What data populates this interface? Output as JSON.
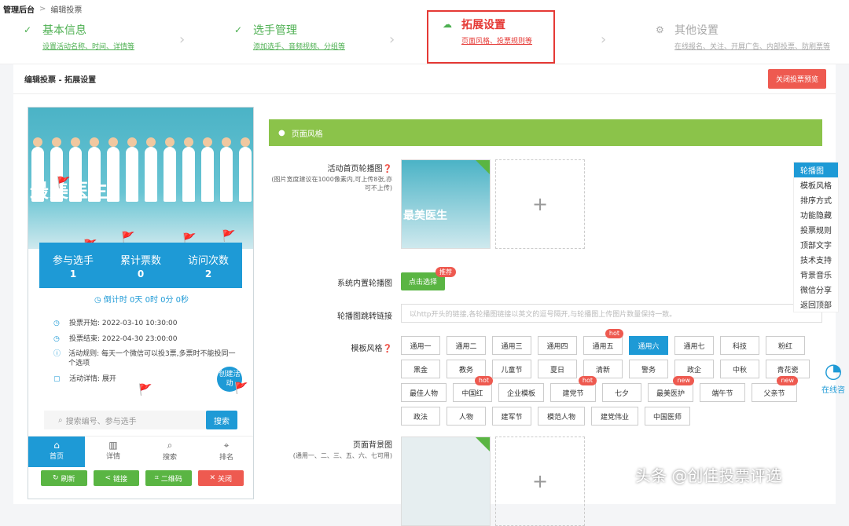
{
  "breadcrumb": {
    "home": "管理后台",
    "sep": ">",
    "current": "编辑投票"
  },
  "steps": [
    {
      "title": "基本信息",
      "sub": "设置活动名称、时间、详情等",
      "status": "done"
    },
    {
      "title": "选手管理",
      "sub": "添加选手、音频视频、分组等",
      "status": "done"
    },
    {
      "title": "拓展设置",
      "sub": "页面风格、投票规则等",
      "status": "active"
    },
    {
      "title": "其他设置",
      "sub": "在线报名、关注、开屏广告、内部投票、防刷票等",
      "status": "pending"
    }
  ],
  "panel": {
    "title": "编辑投票 - 拓展设置",
    "close_preview": "关闭投票预览"
  },
  "preview": {
    "banner_title": "最美医生",
    "stats": [
      {
        "label": "参与选手",
        "value": "1"
      },
      {
        "label": "累计票数",
        "value": "0"
      },
      {
        "label": "访问次数",
        "value": "2"
      }
    ],
    "countdown": "倒计时 0天 0时 0分 0秒",
    "info": [
      {
        "icon": "clock-icon",
        "glyph": "◷",
        "text": "投票开始: 2022-03-10 10:30:00"
      },
      {
        "icon": "clock-icon",
        "glyph": "◷",
        "text": "投票结束: 2022-04-30 23:00:00"
      },
      {
        "icon": "info-icon",
        "glyph": "ⓘ",
        "text": "活动规则: 每天一个微信可以投3票,多票时不能投同一个选项"
      },
      {
        "icon": "detail-icon",
        "glyph": "▢",
        "text": "活动详情: 展开"
      }
    ],
    "create_btn": "创建活动",
    "search_placeholder": "搜索编号、参与选手",
    "search_btn": "搜索",
    "tabs": [
      {
        "icon": "home-icon",
        "glyph": "⌂",
        "label": "首页"
      },
      {
        "icon": "bar-chart-icon",
        "glyph": "▥",
        "label": "详情"
      },
      {
        "icon": "search-icon",
        "glyph": "⌕",
        "label": "搜索"
      },
      {
        "icon": "location-icon",
        "glyph": "⌖",
        "label": "排名"
      }
    ],
    "actions": [
      {
        "label": "刷新",
        "glyph": "↻"
      },
      {
        "label": "链接",
        "glyph": "<"
      },
      {
        "label": "二维码",
        "glyph": "⌗"
      },
      {
        "label": "关闭",
        "glyph": "✕"
      }
    ]
  },
  "form": {
    "section_title": "页面风格",
    "carousel_label": "活动首页轮播图",
    "carousel_hint": "(图片宽度建议在1000像素内,可上传8张,亦可不上传)",
    "thumb_text": "最美医生",
    "system_carousel_label": "系统内置轮播图",
    "choose_btn": "点击选择",
    "recommend_badge": "推荐",
    "jump_label": "轮播图跳转链接",
    "jump_placeholder": "以http开头的链接,各轮播图链接以英文的逗号隔开,与轮播图上传图片数量保持一致。",
    "template_label": "模板风格",
    "templates": [
      [
        {
          "n": "通用一"
        },
        {
          "n": "通用二"
        },
        {
          "n": "通用三"
        },
        {
          "n": "通用四"
        },
        {
          "n": "通用五",
          "b": "hot"
        },
        {
          "n": "通用六",
          "active": true
        },
        {
          "n": "通用七"
        },
        {
          "n": "科技"
        },
        {
          "n": "粉红"
        }
      ],
      [
        {
          "n": "黑金"
        },
        {
          "n": "教务"
        },
        {
          "n": "儿童节"
        },
        {
          "n": "夏日"
        },
        {
          "n": "清新"
        },
        {
          "n": "警务"
        },
        {
          "n": "政企"
        },
        {
          "n": "中秋"
        },
        {
          "n": "青花瓷"
        }
      ],
      [
        {
          "n": "最佳人物"
        },
        {
          "n": "中国红",
          "b": "hot"
        },
        {
          "n": "企业模板"
        },
        {
          "n": "建党节",
          "b": "hot"
        },
        {
          "n": "七夕"
        },
        {
          "n": "最美医护",
          "b": "new"
        },
        {
          "n": "端午节"
        },
        {
          "n": "父亲节",
          "b": "new"
        }
      ],
      [
        {
          "n": "政法"
        },
        {
          "n": "人物"
        },
        {
          "n": "建军节"
        },
        {
          "n": "模范人物"
        },
        {
          "n": "建党伟业"
        },
        {
          "n": "中国医师"
        }
      ]
    ],
    "bg_label": "页面背景图",
    "bg_hint": "(通用一、二、三、五、六、七可用)",
    "plus": "+"
  },
  "sidenav": [
    "轮播图",
    "模板风格",
    "排序方式",
    "功能隐藏",
    "投票规则",
    "顶部文字",
    "技术支持",
    "背景音乐",
    "微信分享",
    "返回顶部"
  ],
  "consult": "在线咨",
  "watermark": "头条 @创佳投票评选"
}
